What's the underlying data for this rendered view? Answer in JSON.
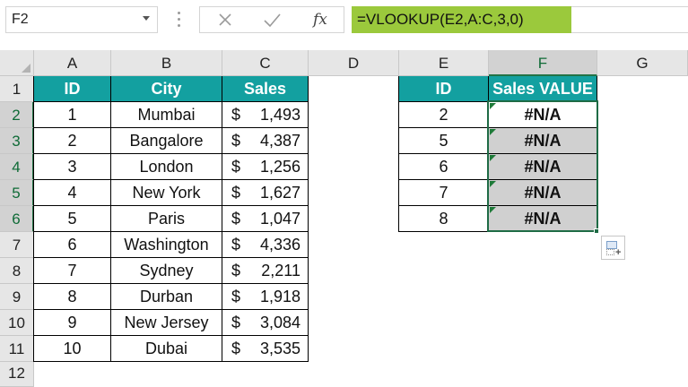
{
  "name_box": "F2",
  "formula_bar": {
    "cancel_icon": "x-icon",
    "enter_icon": "checkmark-icon",
    "fx_label": "fx",
    "formula": "=VLOOKUP(E2,A:C,3,0)"
  },
  "columns": [
    "A",
    "B",
    "C",
    "D",
    "E",
    "F",
    "G"
  ],
  "rows": [
    "1",
    "2",
    "3",
    "4",
    "5",
    "6",
    "7",
    "8",
    "9",
    "10",
    "11",
    "12"
  ],
  "table_left": {
    "headers": [
      "ID",
      "City",
      "Sales"
    ],
    "rows": [
      {
        "id": "1",
        "city": "Mumbai",
        "currency": "$",
        "sales": "1,493"
      },
      {
        "id": "2",
        "city": "Bangalore",
        "currency": "$",
        "sales": "4,387"
      },
      {
        "id": "3",
        "city": "London",
        "currency": "$",
        "sales": "1,256"
      },
      {
        "id": "4",
        "city": "New York",
        "currency": "$",
        "sales": "1,627"
      },
      {
        "id": "5",
        "city": "Paris",
        "currency": "$",
        "sales": "1,047"
      },
      {
        "id": "6",
        "city": "Washington",
        "currency": "$",
        "sales": "4,336"
      },
      {
        "id": "7",
        "city": "Sydney",
        "currency": "$",
        "sales": "2,211"
      },
      {
        "id": "8",
        "city": "Durban",
        "currency": "$",
        "sales": "1,918"
      },
      {
        "id": "9",
        "city": "New Jersey",
        "currency": "$",
        "sales": "3,084"
      },
      {
        "id": "10",
        "city": "Dubai",
        "currency": "$",
        "sales": "3,535"
      }
    ]
  },
  "table_right": {
    "headers": [
      "ID",
      "Sales VALUE"
    ],
    "rows": [
      {
        "id": "2",
        "value": "#N/A"
      },
      {
        "id": "5",
        "value": "#N/A"
      },
      {
        "id": "6",
        "value": "#N/A"
      },
      {
        "id": "7",
        "value": "#N/A"
      },
      {
        "id": "8",
        "value": "#N/A"
      }
    ]
  },
  "colors": {
    "header_fill": "#13a0a0",
    "formula_highlight": "#9bc93c",
    "selection": "#1e6b45",
    "selected_cell_fill": "#d0d0d0"
  },
  "quick_analysis_icon": "quick-analysis-icon"
}
